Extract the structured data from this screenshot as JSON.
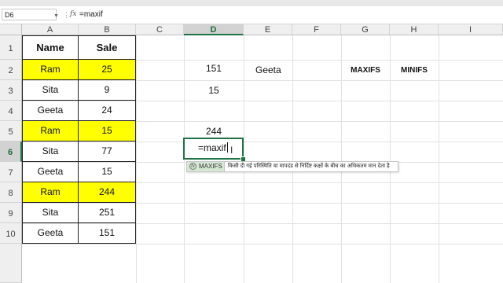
{
  "formula_bar": {
    "name_box": "D6",
    "fx": "fx",
    "content": "=maxif"
  },
  "columns": [
    "A",
    "B",
    "C",
    "D",
    "E",
    "F",
    "G",
    "H",
    "I"
  ],
  "rows": [
    "1",
    "2",
    "3",
    "4",
    "5",
    "6",
    "7",
    "8",
    "9",
    "10"
  ],
  "table": {
    "headers": [
      "Name",
      "Sale"
    ],
    "rows": [
      [
        "Ram",
        "25"
      ],
      [
        "Sita",
        "9"
      ],
      [
        "Geeta",
        "24"
      ],
      [
        "Ram",
        "15"
      ],
      [
        "Sita",
        "77"
      ],
      [
        "Geeta",
        "15"
      ],
      [
        "Ram",
        "244"
      ],
      [
        "Sita",
        "251"
      ],
      [
        "Geeta",
        "151"
      ]
    ]
  },
  "cells": {
    "D2": "151",
    "D3": "15",
    "D5": "244",
    "E2": "Geeta",
    "G2": "MAXIFS",
    "H2": "MINIFS"
  },
  "active_cell": {
    "ref": "D6",
    "text": "=maxif"
  },
  "autocomplete": {
    "icon": "fx",
    "function_name": "MAXIFS",
    "description": "किसी दी गई परिस्थिति या मापदंड से निर्दिष्ट कक्षों के बीच का अधिकतम मान देता है"
  },
  "colors": {
    "highlight": "#ffff00",
    "excel_green": "#217346"
  }
}
